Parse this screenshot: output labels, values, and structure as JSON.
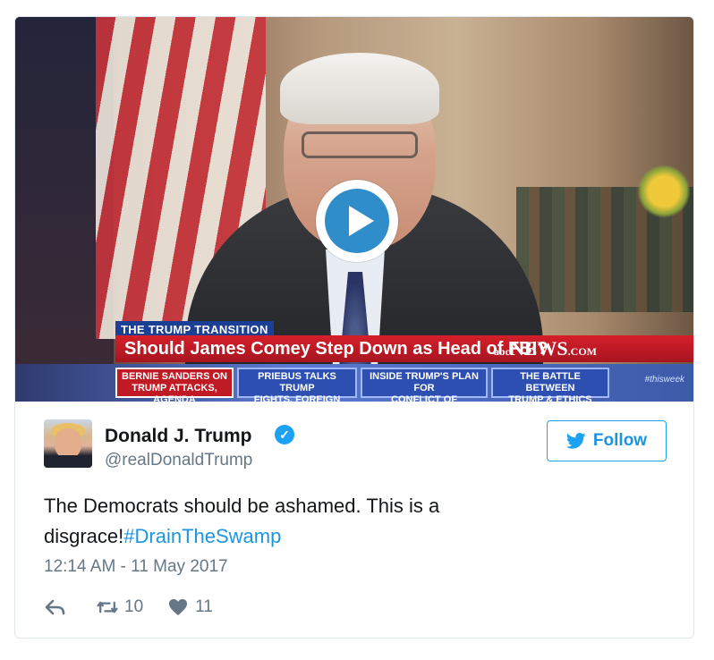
{
  "media": {
    "chyron": {
      "tag": "THE TRUMP TRANSITION",
      "headline": "Should James Comey Step Down as Head of FBI?",
      "network_prefix": "abc",
      "network": "NEWS",
      "network_suffix": ".COM"
    },
    "ticker": [
      {
        "line1": "BERNIE SANDERS ON",
        "line2": "TRUMP ATTACKS, AGENDA"
      },
      {
        "line1": "PRIEBUS TALKS TRUMP",
        "line2": "FIGHTS, FOREIGN POLICY"
      },
      {
        "line1": "INSIDE TRUMP'S PLAN FOR",
        "line2": "CONFLICT OF INTEREST"
      },
      {
        "line1": "THE BATTLE BETWEEN",
        "line2": "TRUMP & ETHICS OFFICE"
      }
    ],
    "ticker_brand": "#thisweek"
  },
  "author": {
    "name": "Donald J. Trump",
    "handle": "@realDonaldTrump"
  },
  "follow_label": "Follow",
  "tweet": {
    "text": "The Democrats should be ashamed. This is a disgrace!",
    "hashtag": "#DrainTheSwamp",
    "timestamp": "12:14 AM - 11 May 2017"
  },
  "stats": {
    "retweets": "10",
    "likes": "11"
  },
  "colors": {
    "accent": "#1da1f2",
    "link": "#1b95e0",
    "muted": "#657786"
  }
}
